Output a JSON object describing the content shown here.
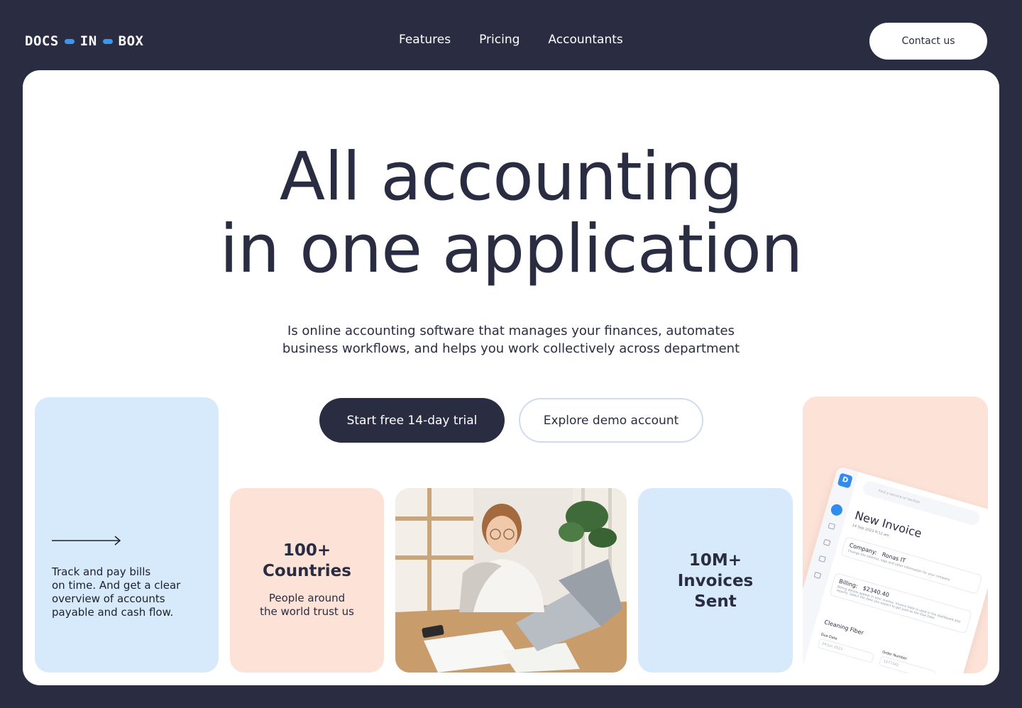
{
  "colors": {
    "navy": "#2a2c42",
    "accent_blue": "#3a97f0",
    "tile_blue": "#d7eafb",
    "tile_peach": "#fde2d7"
  },
  "header": {
    "logo": {
      "word1": "DOCS",
      "word2": "IN",
      "word3": "BOX"
    },
    "nav": [
      "Features",
      "Pricing",
      "Accountants"
    ],
    "contact_label": "Contact us"
  },
  "hero": {
    "title_line1": "All accounting",
    "title_line2": "in one application",
    "subtitle_line1": "Is online accounting software that manages your finances, automates",
    "subtitle_line2": "business workflows, and helps you work collectively across department",
    "primary_cta": "Start free 14-day trial",
    "secondary_cta": "Explore demo account"
  },
  "tiles": {
    "bills": {
      "arrow_icon": "arrow-right-icon",
      "lines": [
        "Track and pay bills",
        "on time. And get a clear",
        "overview of accounts",
        "payable and cash flow."
      ]
    },
    "countries": {
      "num": "100+",
      "label": "Countries",
      "sub_line1": "People around",
      "sub_line2": "the world trust us"
    },
    "invoices": {
      "num": "10M+",
      "line2": "Invoices",
      "line3": "Sent"
    },
    "mockup": {
      "logo": "D",
      "search_placeholder": "Find a service or section",
      "title": "New Invoice",
      "date": "14 Sep 2023    9:12 am",
      "company_label": "Company:",
      "company_value": "Ronas IT",
      "company_hint": "Change the address, logo and other information for your company",
      "billing_label": "Billing:",
      "billing_value": "$2340.40",
      "billing_hint": "Billing details appear in your invoice. Invoice Date is used in the dashboard and reports. Select the date you expect to get paid as the Due Date",
      "item": "Cleaning Fiber",
      "due_date_label": "Due Date",
      "due_date_value": "24 Jun 2023",
      "order_label": "Order Number",
      "order_value": "1277342"
    }
  }
}
